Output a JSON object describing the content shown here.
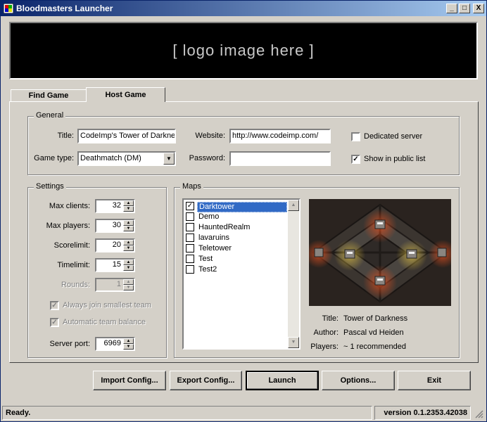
{
  "window": {
    "title": "Bloodmasters Launcher",
    "controls": {
      "minimize": "_",
      "maximize": "□",
      "close": "X"
    }
  },
  "logo": {
    "text": "[ logo image here ]"
  },
  "tabs": [
    {
      "label": "Find Game",
      "selected": false
    },
    {
      "label": "Host Game",
      "selected": true
    }
  ],
  "general": {
    "legend": "General",
    "title_label": "Title:",
    "title_value": "CodeImp's Tower of Darkne",
    "website_label": "Website:",
    "website_value": "http://www.codeimp.com/",
    "gametype_label": "Game type:",
    "gametype_value": "Deathmatch (DM)",
    "password_label": "Password:",
    "password_value": "",
    "dedicated_label": "Dedicated server",
    "dedicated_checked": false,
    "public_label": "Show in public list",
    "public_checked": true
  },
  "settings": {
    "legend": "Settings",
    "max_clients_label": "Max clients:",
    "max_clients": "32",
    "max_players_label": "Max players:",
    "max_players": "30",
    "scorelimit_label": "Scorelimit:",
    "scorelimit": "20",
    "timelimit_label": "Timelimit:",
    "timelimit": "15",
    "rounds_label": "Rounds:",
    "rounds": "1",
    "join_smallest_label": "Always join smallest team",
    "auto_balance_label": "Automatic team balance",
    "server_port_label": "Server port:",
    "server_port": "6969"
  },
  "maps": {
    "legend": "Maps",
    "items": [
      {
        "name": "Darktower",
        "checked": true,
        "selected": true
      },
      {
        "name": "Demo",
        "checked": false,
        "selected": false
      },
      {
        "name": "HauntedRealm",
        "checked": false,
        "selected": false
      },
      {
        "name": "lavaruins",
        "checked": false,
        "selected": false
      },
      {
        "name": "Teletower",
        "checked": false,
        "selected": false
      },
      {
        "name": "Test",
        "checked": false,
        "selected": false
      },
      {
        "name": "Test2",
        "checked": false,
        "selected": false
      }
    ],
    "info": {
      "title_label": "Title:",
      "title": "Tower of Darkness",
      "author_label": "Author:",
      "author": "Pascal vd Heiden",
      "players_label": "Players:",
      "players": "~ 1 recommended"
    }
  },
  "buttons": {
    "import": "Import Config...",
    "export": "Export Config...",
    "launch": "Launch",
    "options": "Options...",
    "exit": "Exit"
  },
  "status": {
    "text": "Ready.",
    "version": "version 0.1.2353.42038"
  },
  "colors": {
    "titlebar_start": "#0a246a",
    "titlebar_end": "#a6caf0",
    "face": "#d4d0c8",
    "selection": "#316ac5"
  }
}
